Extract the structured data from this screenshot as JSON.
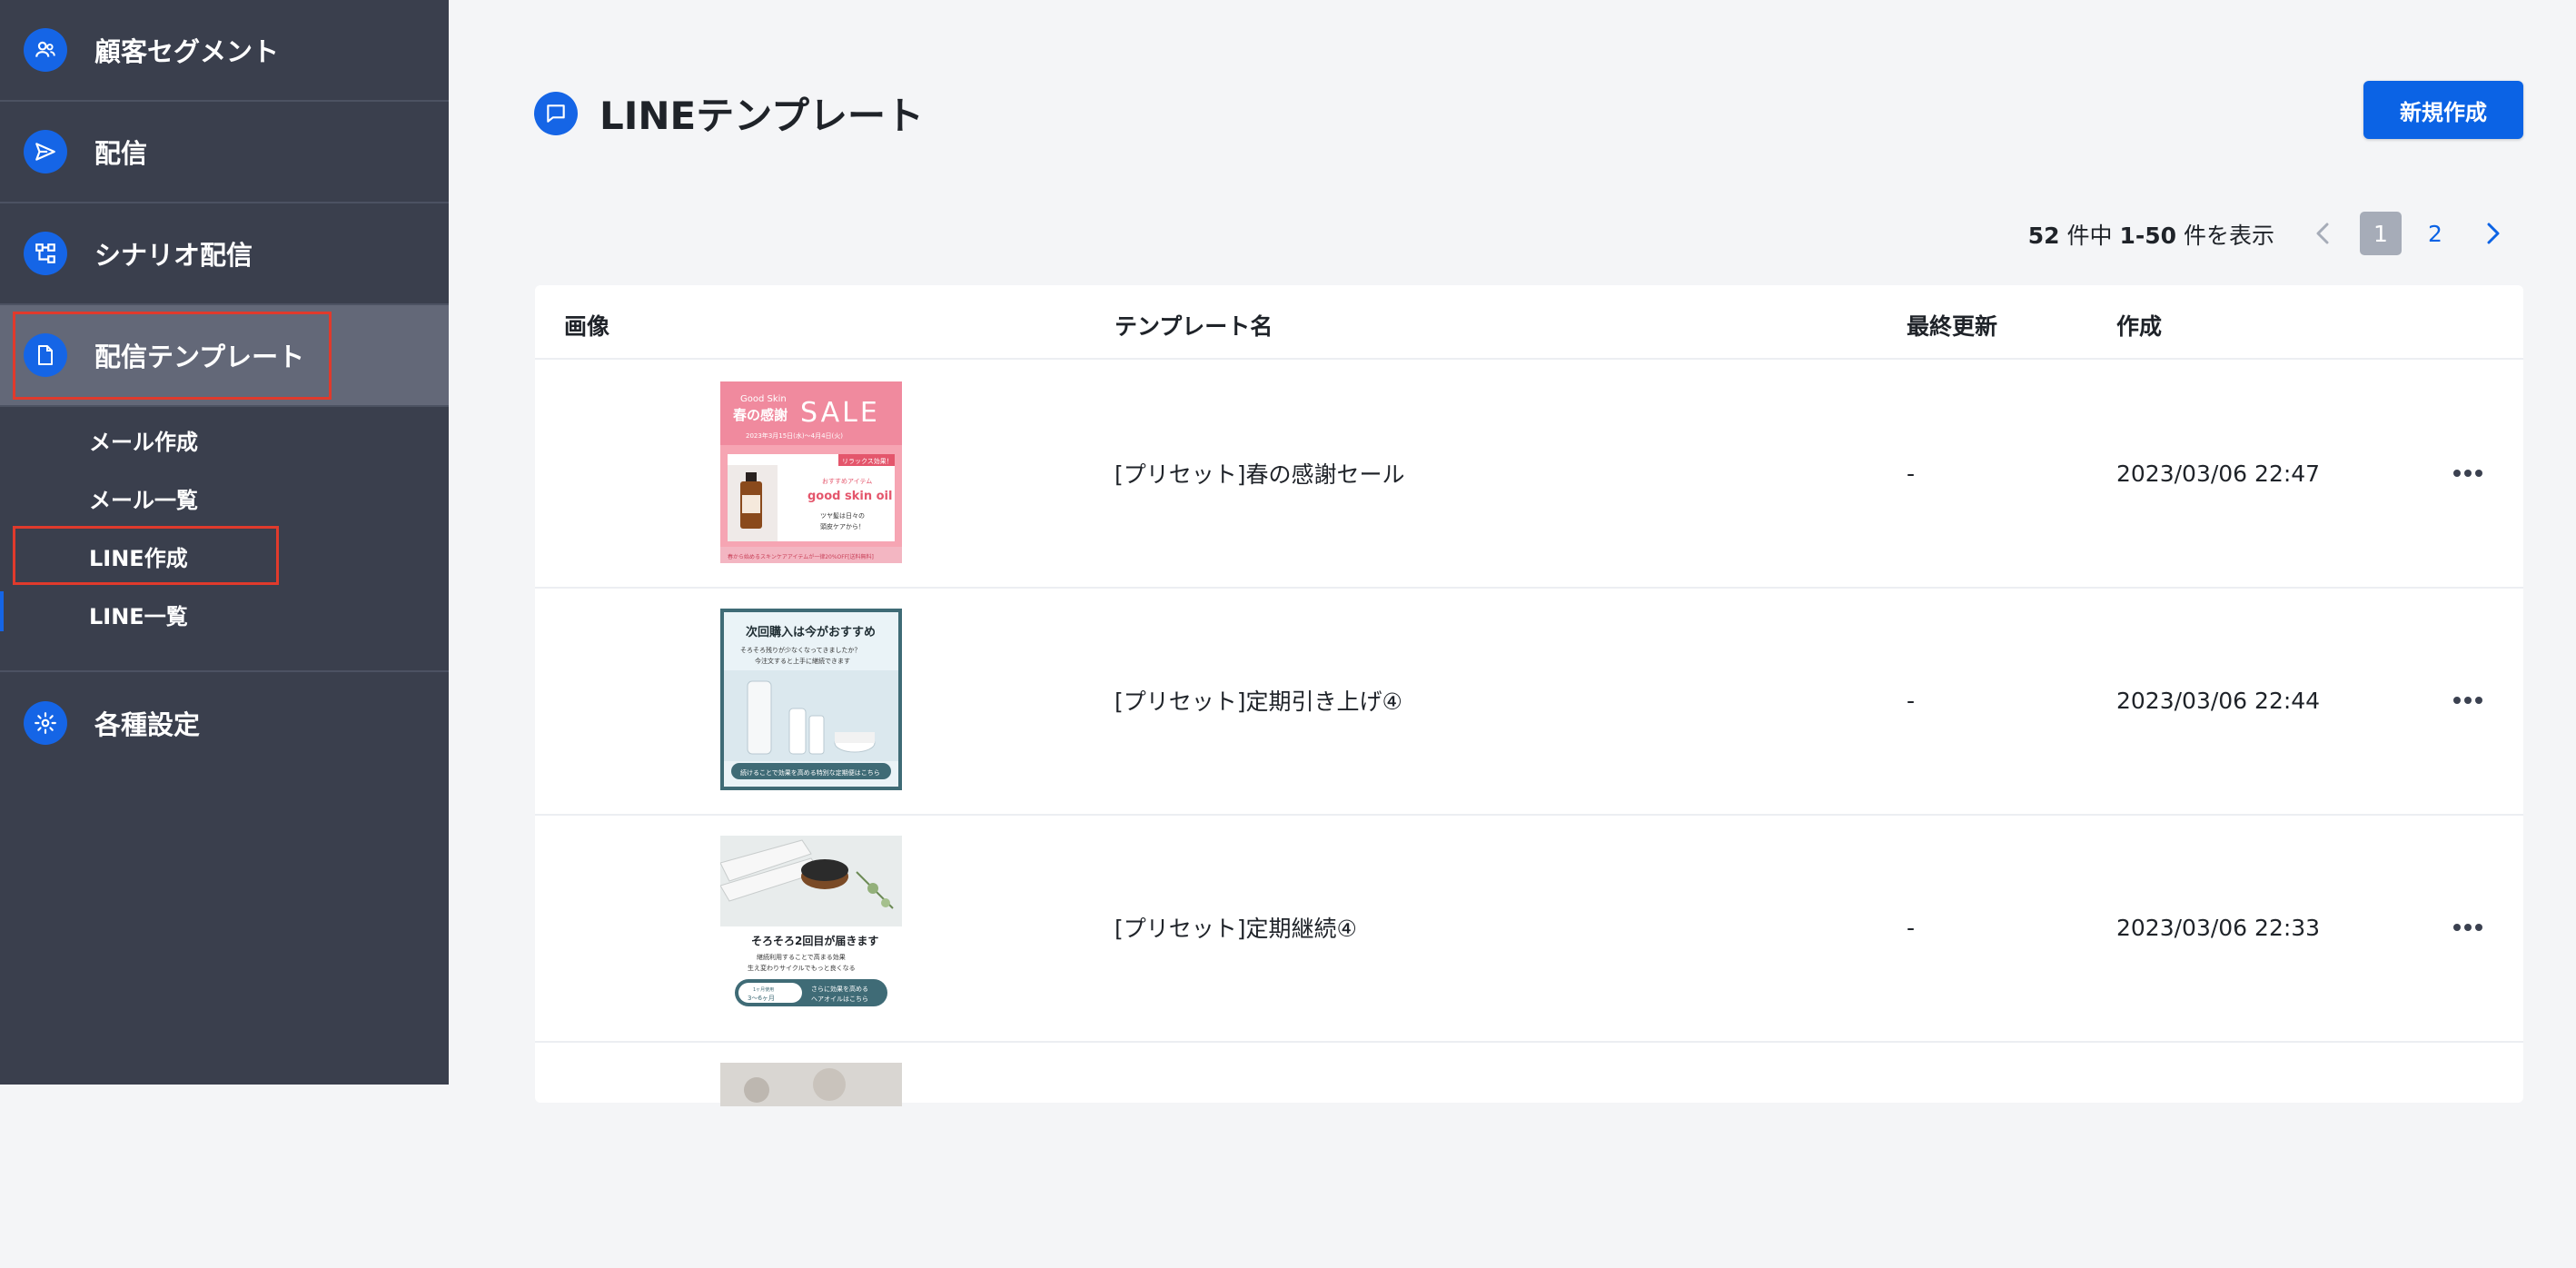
{
  "sidebar": {
    "items": [
      {
        "label": "顧客セグメント",
        "icon": "users-icon"
      },
      {
        "label": "配信",
        "icon": "send-icon"
      },
      {
        "label": "シナリオ配信",
        "icon": "flow-icon"
      },
      {
        "label": "配信テンプレート",
        "icon": "document-icon"
      },
      {
        "label": "各種設定",
        "icon": "gear-icon"
      }
    ],
    "subitems": [
      {
        "label": "メール作成"
      },
      {
        "label": "メール一覧"
      },
      {
        "label": "LINE作成"
      },
      {
        "label": "LINE一覧"
      }
    ]
  },
  "header": {
    "title": "LINEテンプレート",
    "title_icon": "chat-icon",
    "new_button": "新規作成"
  },
  "pagination": {
    "total": "52",
    "range": "1-50",
    "unit_prefix": "件中",
    "unit_suffix": "件を表示",
    "current_page": "1",
    "other_page": "2"
  },
  "table": {
    "columns": [
      "画像",
      "テンプレート名",
      "最終更新",
      "作成"
    ],
    "rows": [
      {
        "name": "[プリセット]春の感謝セール",
        "updated": "-",
        "created": "2023/03/06 22:47"
      },
      {
        "name": "[プリセット]定期引き上げ④",
        "updated": "-",
        "created": "2023/03/06 22:44"
      },
      {
        "name": "[プリセット]定期継続④",
        "updated": "-",
        "created": "2023/03/06 22:33"
      }
    ]
  },
  "thumbs": {
    "t1": {
      "brand": "Good Skin",
      "season": "春の感謝",
      "sale": "SALE",
      "dates": "2023年3月15日(水)〜4月4日(火)",
      "tag": "リラックス効果！",
      "kicker": "おすすめアイテム",
      "product": "good skin oil",
      "copy1": "ツヤ髪は日々の",
      "copy2": "頭皮ケアから！",
      "footer": "春から始めるスキンケアアイテムが一律20%OFF[送料無料]"
    },
    "t2": {
      "headline": "次回購入は今がおすすめ",
      "sub1": "そろそろ残りが少なくなってきましたか？",
      "sub2": "今注文すると上手に継続できます",
      "cta": "続けることで効果を高める特別な定期便はこちら"
    },
    "t3": {
      "headline": "そろそろ2回目が届きます",
      "sub1": "継続利用することで高まる効果",
      "sub2": "生え変わりサイクルでもっと良くなる",
      "badge_small": "1ヶ月使用",
      "badge_big": "3〜6ヶ月",
      "cta1": "さらに効果を高める",
      "cta2": "ヘアオイルはこちら"
    }
  },
  "colors": {
    "sidebar": "#3a3f4d",
    "sidebar_active": "#636878",
    "accent": "#1565e6",
    "highlight_box": "#e03a2c"
  }
}
